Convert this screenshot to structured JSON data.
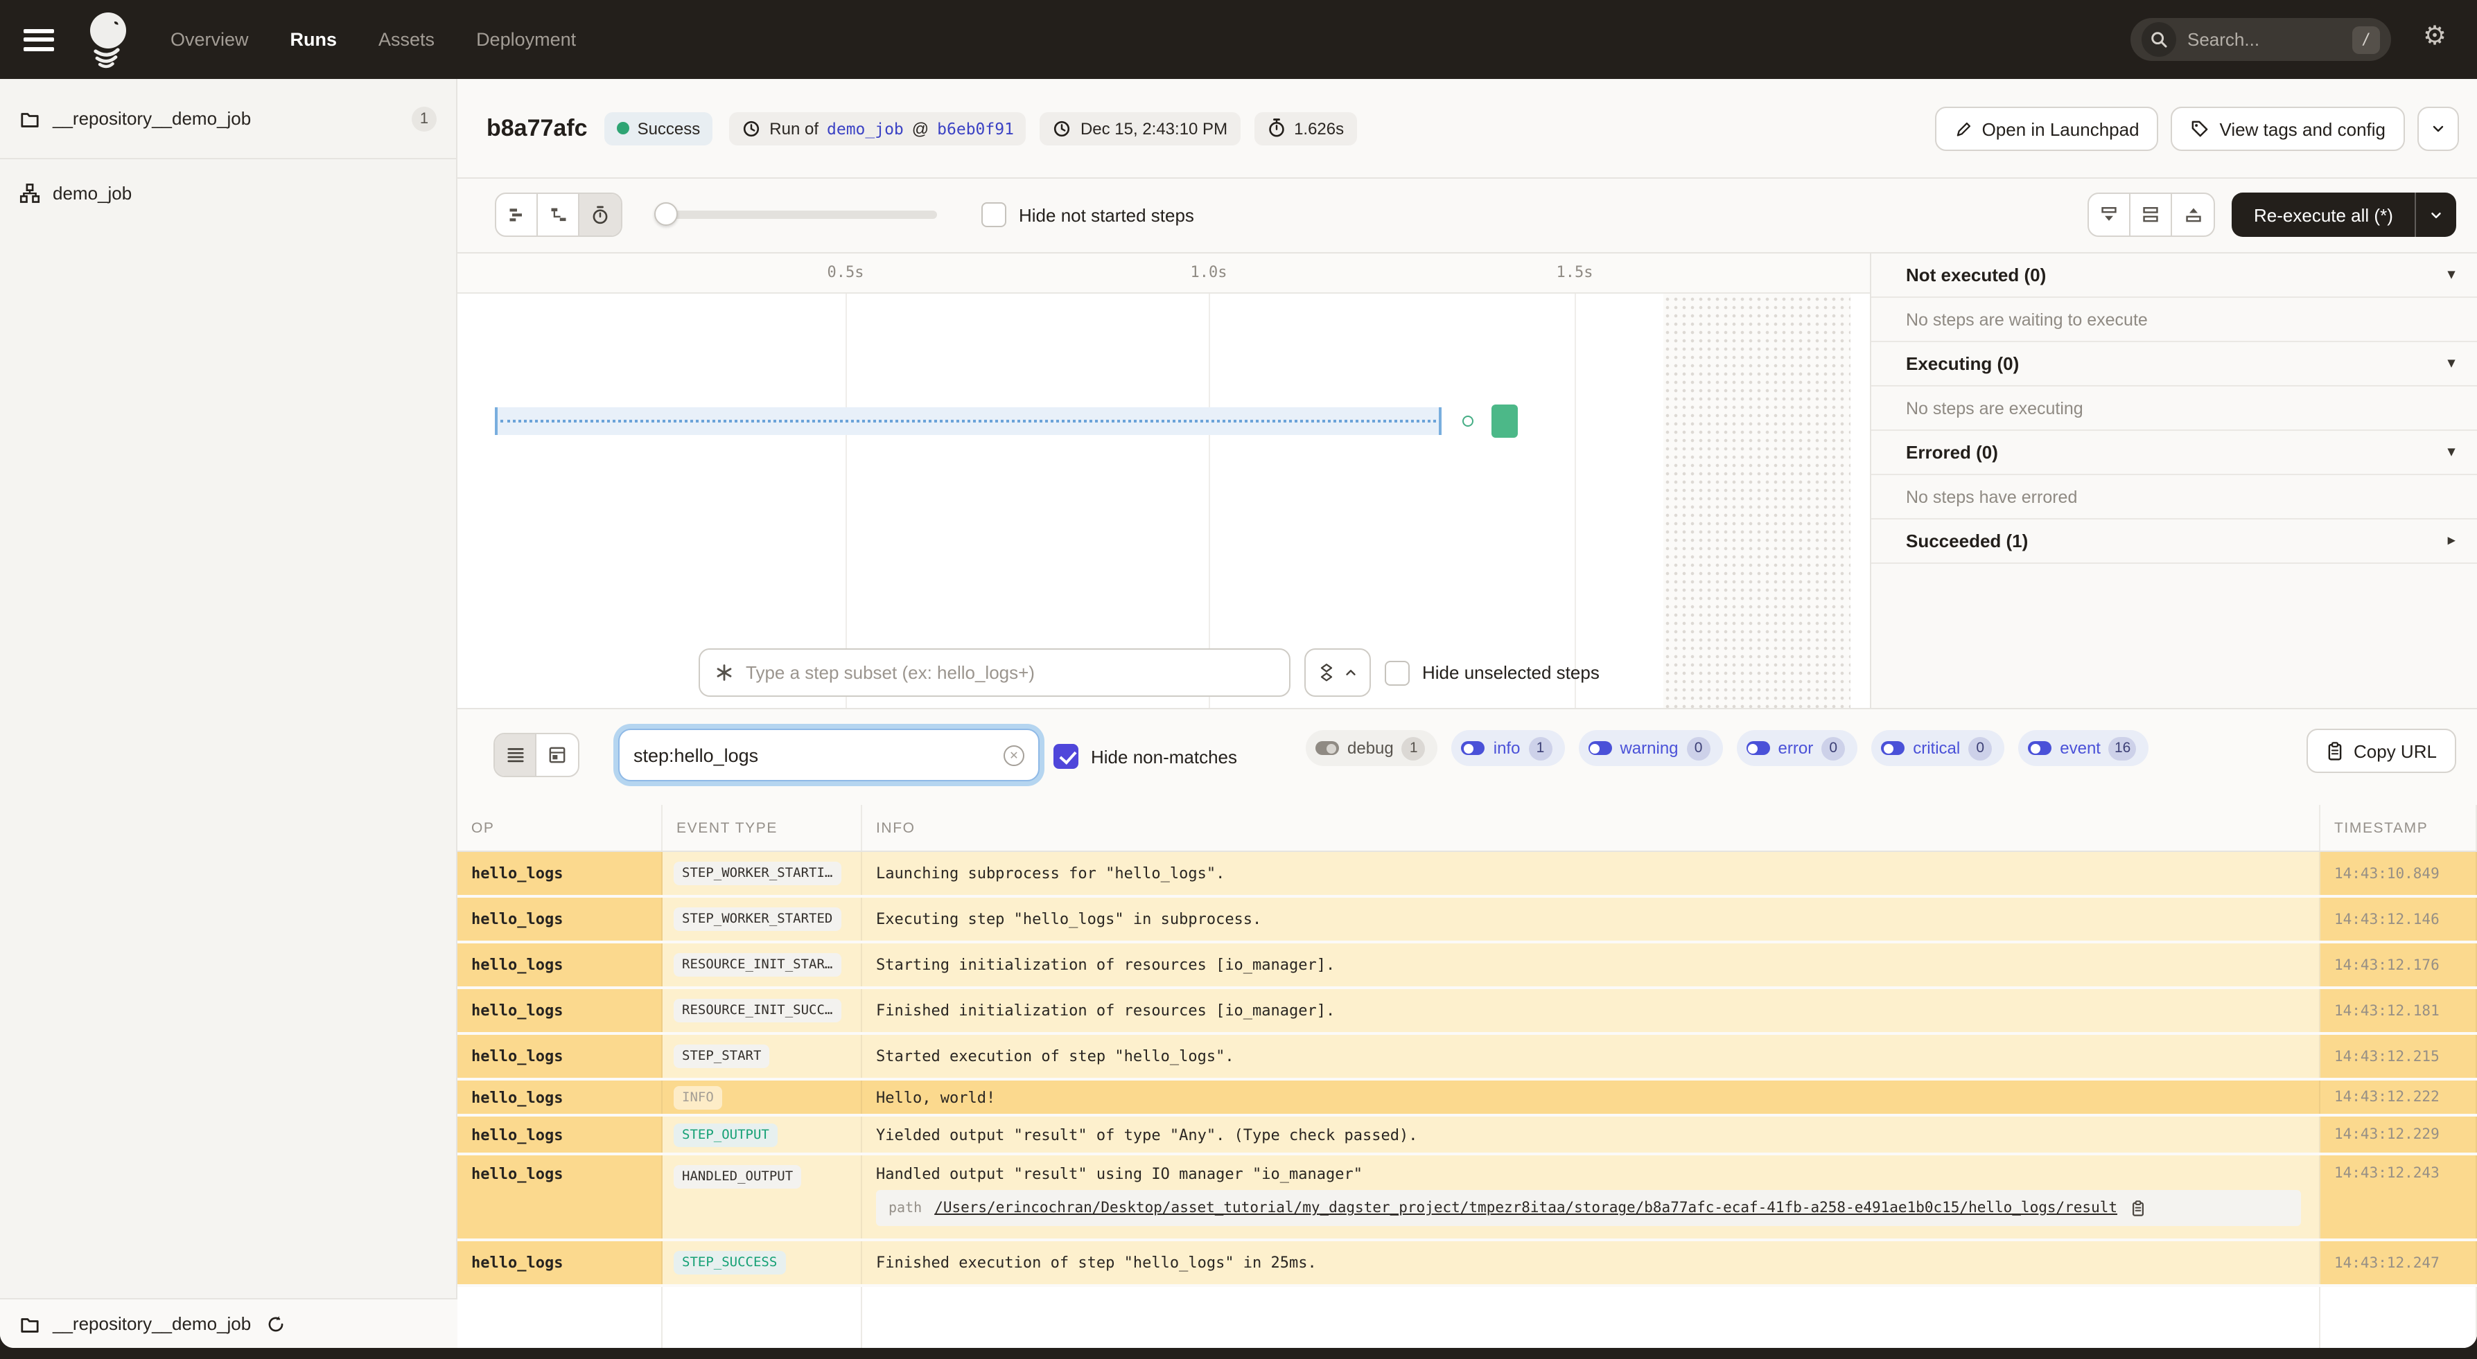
{
  "colors": {
    "accent": "#4f46da",
    "link": "#3b42c4",
    "success": "#2ea473",
    "bar_green": "#4cb888",
    "gantt_blue": "#79aede",
    "row_dark": "#fbd98e",
    "row_light": "#fdf0cd",
    "nav_bg": "#231f1b",
    "page_bg": "#faf9f7"
  },
  "nav": {
    "items": [
      {
        "label": "Overview",
        "active": false
      },
      {
        "label": "Runs",
        "active": true
      },
      {
        "label": "Assets",
        "active": false
      },
      {
        "label": "Deployment",
        "active": false
      }
    ],
    "search_placeholder": "Search...",
    "search_shortcut": "/"
  },
  "sidebar": {
    "repo_label": "__repository__demo_job",
    "repo_count": "1",
    "job_label": "demo_job",
    "footer_label": "__repository__demo_job"
  },
  "header": {
    "run_id": "b8a77afc",
    "status": "Success",
    "run_of_prefix": "Run of",
    "job_link": "demo_job",
    "at_sep": "@",
    "commit_link": "b6eb0f91",
    "datetime": "Dec 15, 2:43:10 PM",
    "duration": "1.626s",
    "open_launchpad": "Open in Launchpad",
    "view_tags": "View tags and config"
  },
  "gantt": {
    "hide_not_started": "Hide not started steps",
    "ticks": [
      "0.5s",
      "1.0s",
      "1.5s"
    ],
    "reexecute": "Re-execute all (*)",
    "subset_placeholder": "Type a step subset (ex: hello_logs+)",
    "hide_unselected": "Hide unselected steps"
  },
  "right_panel": {
    "sections": [
      {
        "title": "Not executed (0)",
        "message": "No steps are waiting to execute",
        "expanded": true
      },
      {
        "title": "Executing (0)",
        "message": "No steps are executing",
        "expanded": true
      },
      {
        "title": "Errored (0)",
        "message": "No steps have errored",
        "expanded": true
      },
      {
        "title": "Succeeded (1)",
        "message": "",
        "expanded": false
      }
    ]
  },
  "logs": {
    "filter_value": "step:hello_logs",
    "hide_non_matches": "Hide non-matches",
    "levels": [
      {
        "label": "debug",
        "count": "1",
        "on": false
      },
      {
        "label": "info",
        "count": "1",
        "on": true
      },
      {
        "label": "warning",
        "count": "0",
        "on": true
      },
      {
        "label": "error",
        "count": "0",
        "on": true
      },
      {
        "label": "critical",
        "count": "0",
        "on": true
      },
      {
        "label": "event",
        "count": "16",
        "on": true
      }
    ],
    "copy_url": "Copy URL",
    "columns": [
      "OP",
      "EVENT TYPE",
      "INFO",
      "TIMESTAMP"
    ],
    "rows": [
      {
        "op": "hello_logs",
        "event_type": "STEP_WORKER_STARTI…",
        "badge": "default",
        "info": "Launching subprocess for \"hello_logs\".",
        "timestamp": "14:43:10.849"
      },
      {
        "op": "hello_logs",
        "event_type": "STEP_WORKER_STARTED",
        "badge": "default",
        "info": "Executing step \"hello_logs\" in subprocess.",
        "timestamp": "14:43:12.146"
      },
      {
        "op": "hello_logs",
        "event_type": "RESOURCE_INIT_STAR…",
        "badge": "default",
        "info": "Starting initialization of resources [io_manager].",
        "timestamp": "14:43:12.176"
      },
      {
        "op": "hello_logs",
        "event_type": "RESOURCE_INIT_SUCC…",
        "badge": "default",
        "info": "Finished initialization of resources [io_manager].",
        "timestamp": "14:43:12.181"
      },
      {
        "op": "hello_logs",
        "event_type": "STEP_START",
        "badge": "default",
        "info": "Started execution of step \"hello_logs\".",
        "timestamp": "14:43:12.215"
      },
      {
        "op": "hello_logs",
        "event_type": "INFO",
        "badge": "muted",
        "info": "Hello, world!",
        "timestamp": "14:43:12.222",
        "highlight": true
      },
      {
        "op": "hello_logs",
        "event_type": "STEP_OUTPUT",
        "badge": "success",
        "info": "Yielded output \"result\" of type \"Any\". (Type check passed).",
        "timestamp": "14:43:12.229"
      },
      {
        "op": "hello_logs",
        "event_type": "HANDLED_OUTPUT",
        "badge": "default",
        "info": "Handled output \"result\" using IO manager \"io_manager\"",
        "timestamp": "14:43:12.243",
        "path_label": "path",
        "path_value": "/Users/erincochran/Desktop/asset_tutorial/my_dagster_project/tmpezr8itaa/storage/b8a77afc-ecaf-41fb-a258-e491ae1b0c15/hello_logs/result"
      },
      {
        "op": "hello_logs",
        "event_type": "STEP_SUCCESS",
        "badge": "success",
        "info": "Finished execution of step \"hello_logs\" in 25ms.",
        "timestamp": "14:43:12.247"
      }
    ]
  }
}
